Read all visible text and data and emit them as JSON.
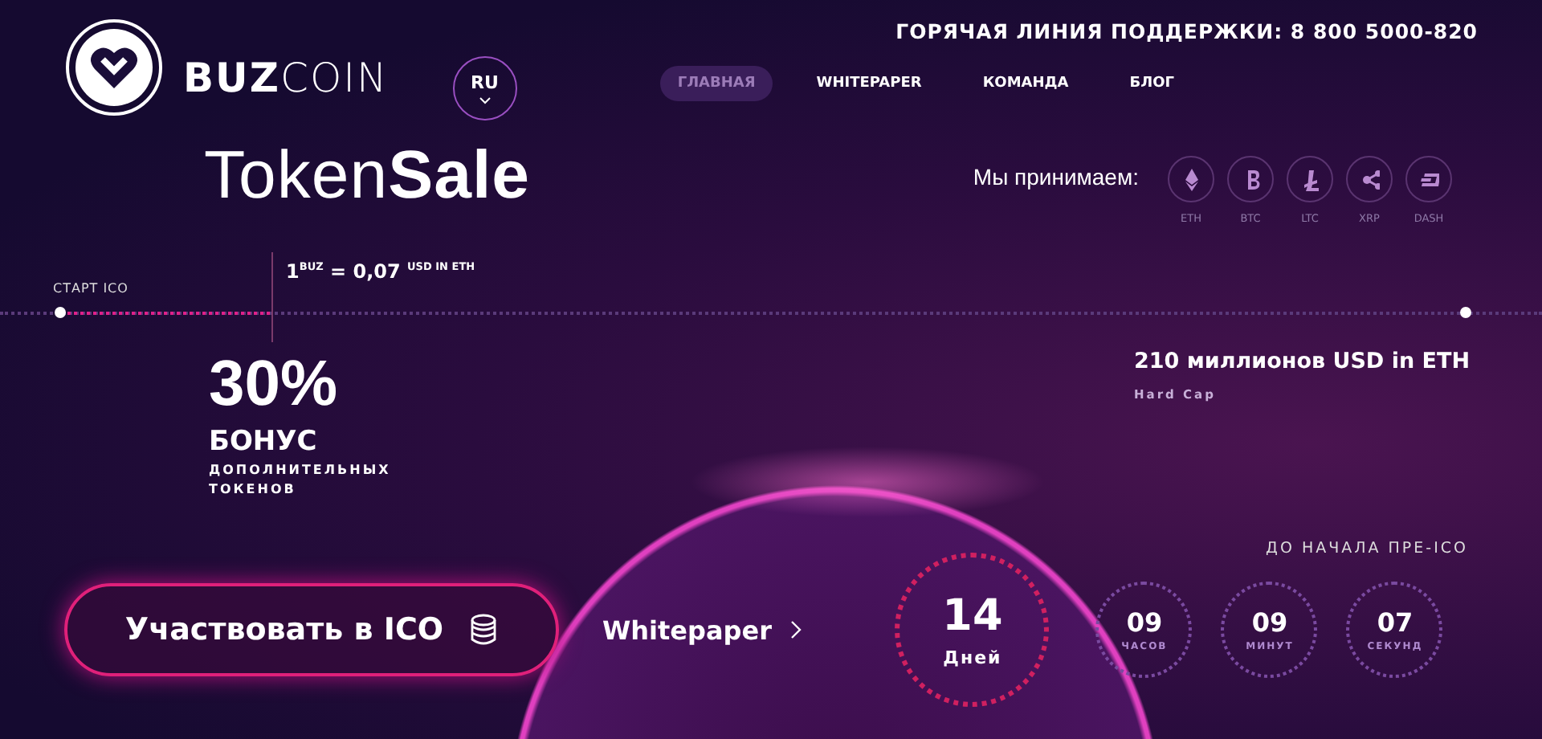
{
  "header": {
    "brand": "**BUZ**COIN",
    "language": "RU",
    "hotline": "ГОРЯЧАЯ ЛИНИЯ ПОДДЕРЖКИ: 8 800 5000-820",
    "nav": [
      {
        "label": "ГЛАВНАЯ",
        "selected": true
      },
      {
        "label": "WHITEPAPER",
        "selected": false
      },
      {
        "label": "КОМАНДА",
        "selected": false
      },
      {
        "label": "БЛОГ",
        "selected": false
      }
    ]
  },
  "title": "Token**Sale**",
  "accepts": {
    "label": "Мы принимаем:",
    "currencies": [
      {
        "kind": "eth",
        "label": "ETH"
      },
      {
        "kind": "btc",
        "label": "BTC"
      },
      {
        "kind": "ltc",
        "label": "LTC"
      },
      {
        "kind": "xrp",
        "label": "XRP"
      },
      {
        "kind": "dash",
        "label": "DASH"
      }
    ]
  },
  "timeline": {
    "start_label": "СТАРТ ICO",
    "price": "1$^{BUZ}$ = 0,07 $^{USD IN ETH}$",
    "level": 0.15
  },
  "bonus": {
    "value": "30%",
    "label": "БОНУС",
    "note": "ДОПОЛНИТЕЛЬНЫХ ТОКЕНОВ"
  },
  "hard_cap": {
    "amount": "210 миллионов USD in ETH",
    "label": "Hard Cap"
  },
  "countdown": {
    "title": "ДО НАЧАЛА ПРЕ-ICO",
    "days": {
      "value": "14",
      "unit": "Дней"
    },
    "units": [
      {
        "value": "09",
        "unit": "ЧАСОВ"
      },
      {
        "value": "09",
        "unit": "МИНУТ"
      },
      {
        "value": "07",
        "unit": "СЕКУНД"
      }
    ]
  },
  "actions": {
    "participate": "Участвовать в ICO",
    "whitepaper": "Whitepaper"
  }
}
